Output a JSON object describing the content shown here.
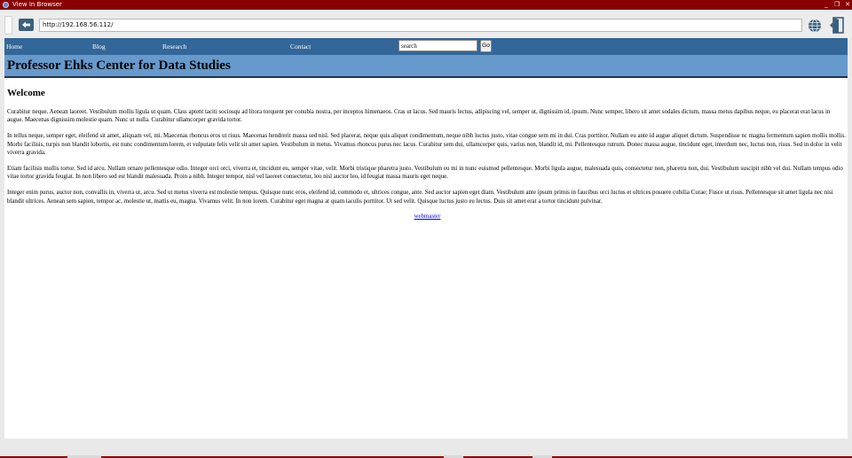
{
  "window": {
    "title": "View In Browser",
    "controls": [
      "_",
      "❐",
      "✕"
    ]
  },
  "toolbar": {
    "url": "http://192.168.56.112/",
    "back_icon": "back-arrow-icon",
    "globe_icon": "globe-icon",
    "exit_icon": "exit-door-icon"
  },
  "nav": {
    "items": [
      "Home",
      "Blog",
      "Research",
      "Contact"
    ],
    "search_value": "search",
    "go_label": "Go"
  },
  "page": {
    "site_title": "Professor Ehks Center for Data Studies",
    "heading": "Welcome",
    "paragraphs": [
      "Curabitur neque. Aenean laoreet. Vestibulum mollis ligula ut quam. Class aptent taciti sociosqu ad litora torquent per conubia nostra, per inceptos himenaeos. Cras ut lacus. Sed mauris lectus, adipiscing vel, semper ut, dignissim id, ipsum. Nunc semper, libero sit amet sodales dictum, massa metus dapibus neque, eu placerat erat lacus in augue. Maecenas dignissim molestie quam. Nunc ut nulla. Curabitur ullamcorper gravida tortor.",
      "In tellus neque, semper eget, eleifend sit amet, aliquam vel, mi. Maecenas rhoncus eros ut risus. Maecenas hendrerit massa sed nisl. Sed placerat, neque quis aliquet condimentum, neque nibh luctus justo, vitae congue sem mi in dui. Cras porttitor. Nullam eu ante id augue aliquet dictum. Suspendisse nc magna fermentum sapien mollis mollis. Morbi facilisis, turpis non blandit lobortis, est nunc condimentum lorem, et vulputate felis velit sit amet sapien. Vestibulum in metus. Vivamus rhoncus purus nec lacus. Curabitur sem dui, ullamcorper quis, varius non, blandit id, mi. Pellentesque rutrum. Donec massa augue, tincidunt eget, interdum nec, luctus non, risus. Sed in dolor in velit viverra gravida.",
      "Etiam facilisis mollis tortor. Sed id arcu. Nullam ornare pellentesque odio. Integer orci orci, viverra et, tincidunt eu, semper vitae, velit. Morbi tristique pharetra justo. Vestibulum eu mi in nunc euismod pellentesque. Morbi ligula augue, malesuada quis, consectetur non, pharetra non, dui. Vestibulum suscipit nibh vel dui. Nullam tempus odio vitae tortor gravida feugiat. In non libero sed est blandit malesuada. Proin a nibh. Integer tempor, nisl vel laoreet consectetur, leo nisl auctor leo, id feugiat massa mauris eget neque.",
      "Integer enim purus, auctor non, convallis in, viverra ut, arcu. Sed ut metus viverra est molestie tempus. Quisque nunc eros, eleifend id, commodo et, ultrices congue, ante. Sed auctor sapien eget diam. Vestibulum ante ipsum primis in faucibus orci luctus et ultrices posuere cubilia Curae; Fusce ut risus. Pellentesque sit amet ligula nec nisi blandit ultrices. Aenean sem sapien, tempor ac, molestie ut, mattis eu, magna. Vivamus velit. In non lorem. Curabitur eget magna at quam iaculis porttitor. Ut sed velit. Quisque luctus justo eu lectus. Duis sit amet erat a tortor tincidunt pulvinar."
    ],
    "footer_link": "webmaster"
  },
  "colors": {
    "titlebar": "#8a0000",
    "nav_bg": "#336699",
    "banner_bg": "#6699cc",
    "link": "#0000ee"
  }
}
